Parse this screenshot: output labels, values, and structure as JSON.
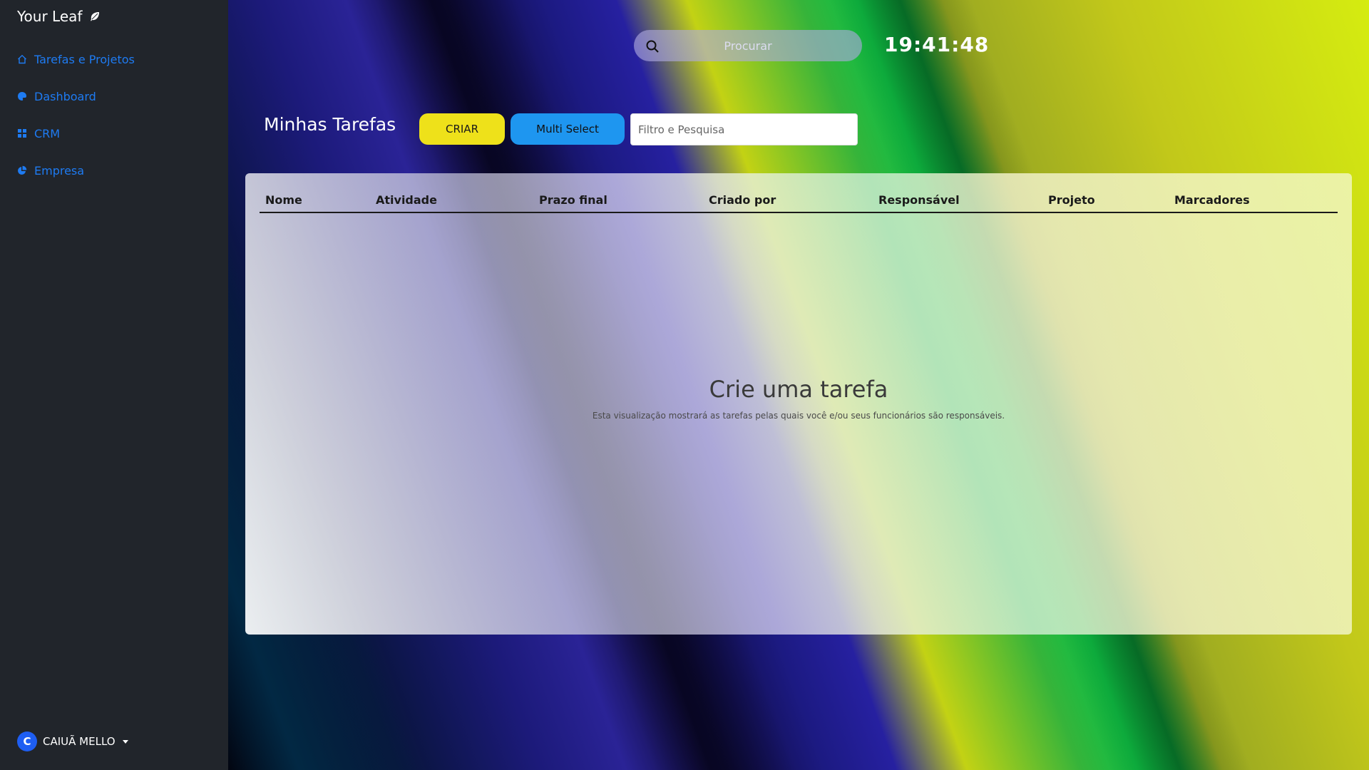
{
  "sidebar": {
    "brand": "Your Leaf",
    "brand_icon": "leaf-icon",
    "items": [
      {
        "label": "Tarefas e Projetos",
        "icon": "home-icon"
      },
      {
        "label": "Dashboard",
        "icon": "palette-icon"
      },
      {
        "label": "CRM",
        "icon": "grid-icon"
      },
      {
        "label": "Empresa",
        "icon": "pie-chart-icon"
      }
    ],
    "user": {
      "initial": "C",
      "name": "CAIUÃ MELLO"
    }
  },
  "header": {
    "search_placeholder": "Procurar",
    "clock": "19:41:48"
  },
  "toolbar": {
    "title": "Minhas Tarefas",
    "create_label": "CRIAR",
    "multi_label": "Multi Select",
    "filter_placeholder": "Filtro e Pesquisa"
  },
  "table": {
    "columns": [
      "Nome",
      "Atividade",
      "Prazo final",
      "Criado por",
      "Responsável",
      "Projeto",
      "Marcadores"
    ]
  },
  "empty": {
    "title": "Crie uma tarefa",
    "subtitle": "Esta visualização mostrará as tarefas pelas quais você e/ou seus funcionários são responsáveis."
  },
  "colors": {
    "accent": "#1e7bf2",
    "create_button": "#eee11a",
    "multi_button": "#1e96f0",
    "sidebar_bg": "#21252b"
  }
}
